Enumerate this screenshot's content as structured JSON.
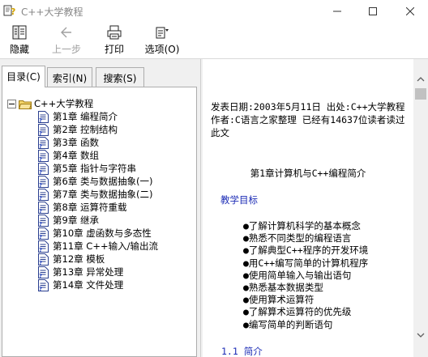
{
  "window": {
    "title": "C++大学教程",
    "controls": {
      "minimize_icon": "minimize-icon",
      "maximize_icon": "maximize-icon",
      "close_icon": "close-icon"
    }
  },
  "toolbar": {
    "hide_label": "隐藏",
    "back_label": "上一步",
    "print_label": "打印",
    "options_label": "选项(O)"
  },
  "tabs": {
    "toc": "目录(C)",
    "index": "索引(N)",
    "search": "搜索(S)",
    "active": "toc"
  },
  "tree": {
    "root": "C++大学教程",
    "items": [
      "第1章 编程简介",
      "第2章 控制结构",
      "第3章 函数",
      "第4章 数组",
      "第5章 指针与字符串",
      "第6章 类与数据抽象(一)",
      "第7章 类与数据抽象(二)",
      "第8章 运算符重载",
      "第9章 继承",
      "第10章 虚函数与多态性",
      "第11章 C++输入/输出流",
      "第12章 模板",
      "第13章 异常处理",
      "第14章 文件处理"
    ]
  },
  "content": {
    "meta_text": "发表日期:2003年5月11日  出处:C++大学教程  作者:C语言之家整理  已经有14637位读者读过此文",
    "chapter_title": "第1章计算机与C++编程简介",
    "goal_label": "教学目标",
    "objectives": [
      "●了解计算机科学的基本概念",
      "●熟悉不同类型的编程语言",
      "●了解典型C++程序的开发环境",
      "●用C++编写简单的计算机程序",
      "●使用简单输入与输出语句",
      "●熟悉基本数据类型",
      "●使用算术运算符",
      "●了解算术运算符的优先级",
      "●编写简单的判断语句"
    ],
    "section_heading": "1.1  简介"
  },
  "colors": {
    "link_blue": "#1a2ab5",
    "pane_bg": "#f0f0f0",
    "border": "#adadad"
  }
}
